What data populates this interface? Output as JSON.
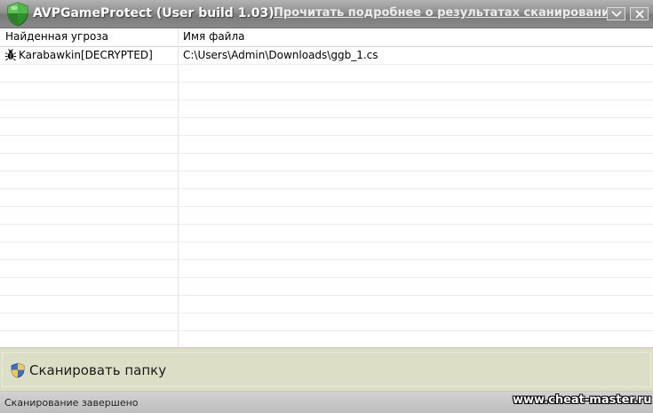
{
  "window": {
    "title": "AVPGameProtect (User build 1.03)",
    "header_link": "Прочитать подробнее о результатах сканирования"
  },
  "grid": {
    "columns": [
      "Найденная угроза",
      "Имя файла"
    ],
    "rows": [
      {
        "threat": "Karabawkin[DECRYPTED]",
        "file": "C:\\Users\\Admin\\Downloads\\ggb_1.cs",
        "icon": "bug-icon"
      },
      {
        "threat": "",
        "file": ""
      },
      {
        "threat": "",
        "file": ""
      },
      {
        "threat": "",
        "file": ""
      },
      {
        "threat": "",
        "file": ""
      },
      {
        "threat": "",
        "file": ""
      },
      {
        "threat": "",
        "file": ""
      },
      {
        "threat": "",
        "file": ""
      },
      {
        "threat": "",
        "file": ""
      },
      {
        "threat": "",
        "file": ""
      },
      {
        "threat": "",
        "file": ""
      },
      {
        "threat": "",
        "file": ""
      },
      {
        "threat": "",
        "file": ""
      },
      {
        "threat": "",
        "file": ""
      },
      {
        "threat": "",
        "file": ""
      },
      {
        "threat": "",
        "file": ""
      },
      {
        "threat": "",
        "file": ""
      }
    ]
  },
  "scan": {
    "button_label": "Сканировать папку",
    "icon": "shield-uac-icon"
  },
  "status": {
    "text": "Сканирование завершено",
    "watermark": "www.cheat-master.ru"
  },
  "colors": {
    "titlebar": "#8f8f8f",
    "scan_panel": "#dcdfc6",
    "shield_green": "#3fa23a"
  }
}
